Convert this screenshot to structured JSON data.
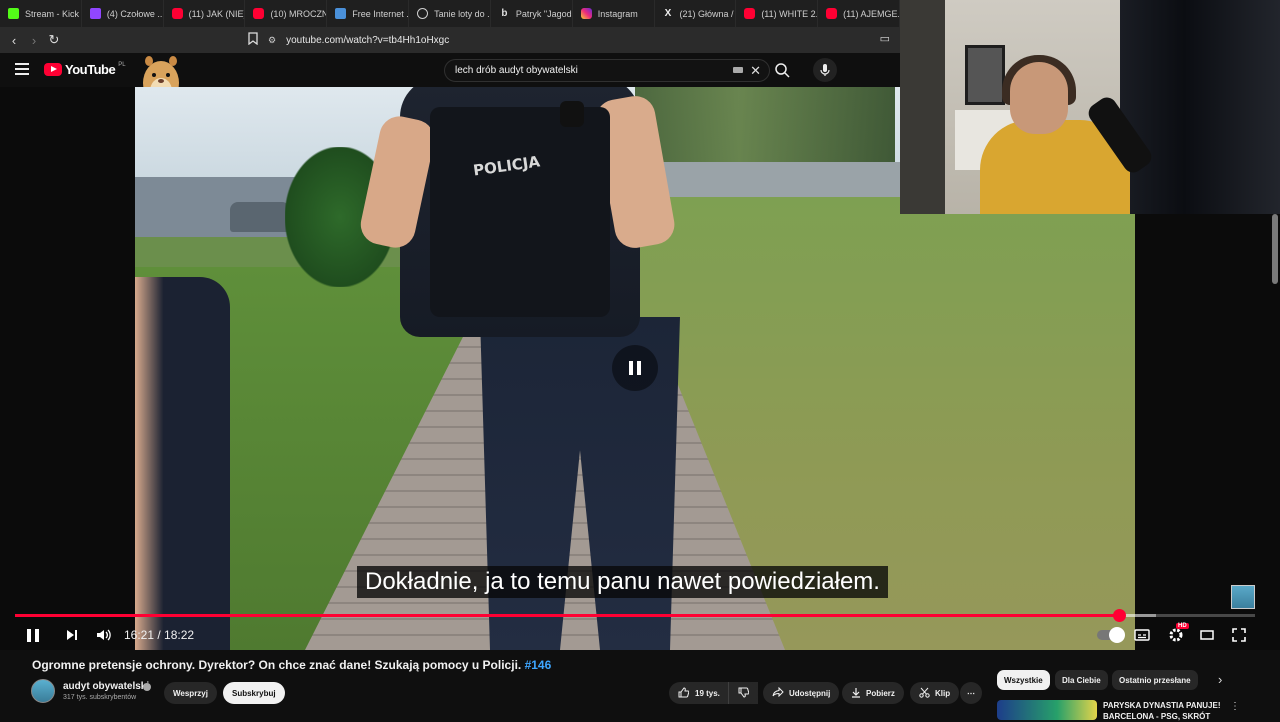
{
  "browser": {
    "tabs": [
      {
        "label": "Stream - Kick",
        "icon": "kick-icon"
      },
      {
        "label": "(4) Czołowe ...",
        "icon": "twitch-icon"
      },
      {
        "label": "(11) JAK (NIE)...",
        "icon": "youtube-icon"
      },
      {
        "label": "(10) MROCZN...",
        "icon": "youtube-icon"
      },
      {
        "label": "Free Internet ...",
        "icon": "web-icon"
      },
      {
        "label": "Tanie loty do ...",
        "icon": "globe-icon"
      },
      {
        "label": "Patryk \"Jagod...",
        "icon": "bing-icon"
      },
      {
        "label": "Instagram",
        "icon": "instagram-icon"
      },
      {
        "label": "(21) Główna / ...",
        "icon": "x-icon"
      },
      {
        "label": "(11) WHITE 2...",
        "icon": "youtube-icon"
      },
      {
        "label": "(11) AJEMGE...",
        "icon": "youtube-icon"
      }
    ],
    "url": "youtube.com/watch?v=tb4Hh1oHxgc"
  },
  "youtube_header": {
    "logo_text": "YouTube",
    "logo_region": "PL",
    "search_value": "lech drób audyt obywatelski"
  },
  "player": {
    "subtitle": "Dokładnie, ja to temu panu nawet powiedziałem.",
    "vest_text": "POLICJA",
    "current_time": "16:21",
    "duration": "18:22",
    "time_separator": " / ",
    "progress_fraction": 0.89,
    "buffer_fraction": 0.92,
    "hd_badge": "HD",
    "accent_color": "#ff0033"
  },
  "video_info": {
    "title": "Ogromne pretensje ochrony. Dyrektor? On chce znać dane! Szukają pomocy u Policji.",
    "hashtag": "#146",
    "channel_name": "audyt obywatelski",
    "subscribers": "317 tys. subskrybentów",
    "support_label": "Wesprzyj",
    "subscribe_label": "Subskrybuj",
    "like_count": "19 tys.",
    "share_label": "Udostępnij",
    "download_label": "Pobierz",
    "clip_label": "Klip"
  },
  "recommendations": {
    "chips": [
      "Wszystkie",
      "Dla Ciebie",
      "Ostatnio przesłane"
    ],
    "first_title": "PARYSKA DYNASTIA PANUJE! BARCELONA - PSG, SKRÓT"
  }
}
